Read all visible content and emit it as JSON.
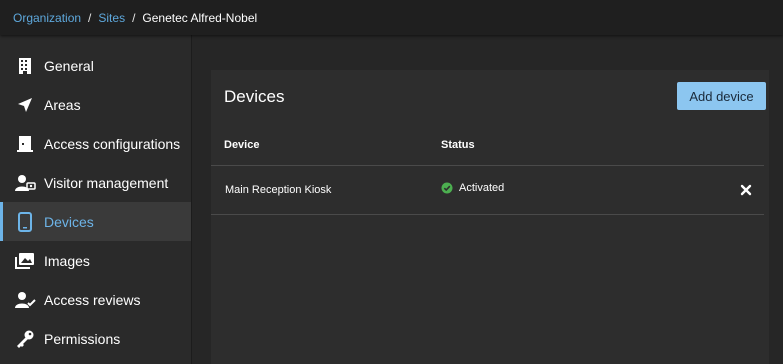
{
  "breadcrumb": {
    "items": [
      "Organization",
      "Sites"
    ],
    "separator": "/",
    "current": "Genetec Alfred-Nobel"
  },
  "sidebar": {
    "items": [
      {
        "label": "General",
        "icon": "building-icon"
      },
      {
        "label": "Areas",
        "icon": "navigation-arrow-icon"
      },
      {
        "label": "Access configurations",
        "icon": "door-icon"
      },
      {
        "label": "Visitor management",
        "icon": "visitor-icon"
      },
      {
        "label": "Devices",
        "icon": "tablet-icon",
        "active": true
      },
      {
        "label": "Images",
        "icon": "images-icon"
      },
      {
        "label": "Access reviews",
        "icon": "user-check-icon"
      },
      {
        "label": "Permissions",
        "icon": "key-icon"
      }
    ]
  },
  "devices": {
    "title": "Devices",
    "add_label": "Add device",
    "columns": {
      "device": "Device",
      "status": "Status"
    },
    "rows": [
      {
        "device": "Main Reception Kiosk",
        "status": "Activated"
      }
    ]
  },
  "colors": {
    "accent": "#6db4e8",
    "button": "#8cc6f0",
    "status_ok": "#4caf50",
    "background": "#262626"
  }
}
